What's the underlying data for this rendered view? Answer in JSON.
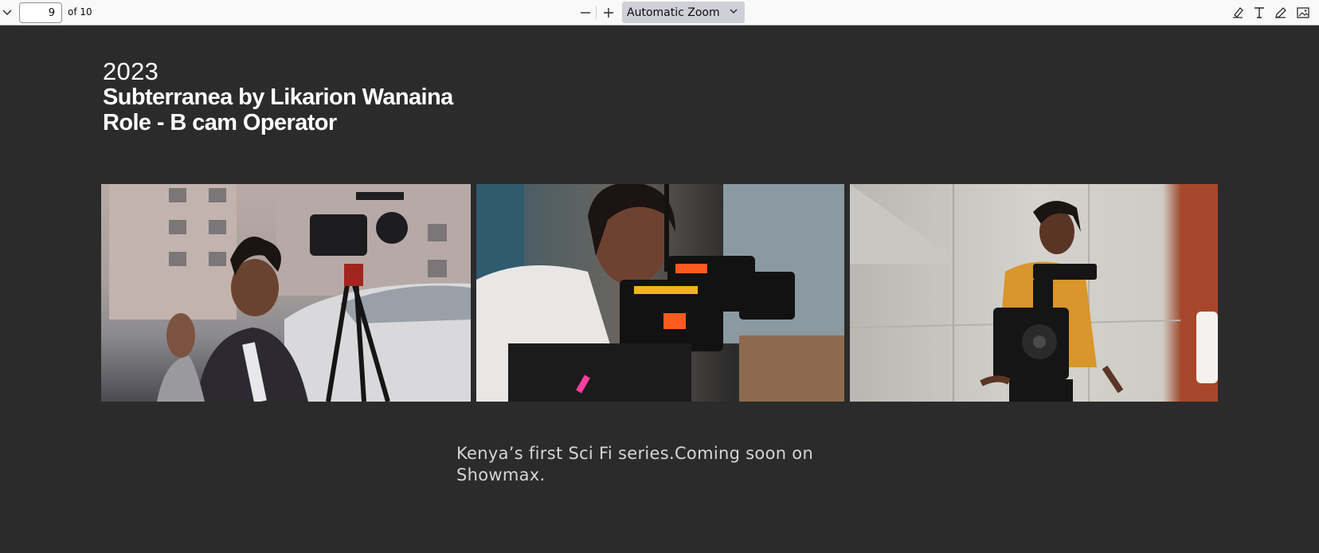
{
  "toolbar": {
    "page_number": "9",
    "page_count": "of 10",
    "zoom_value": "Automatic Zoom",
    "icons": {
      "sidebar": "chevron-down-icon",
      "zoom_out": "minus-icon",
      "zoom_in": "plus-icon",
      "highlight": "highlighter-icon",
      "text": "text-icon",
      "draw": "pen-icon",
      "image": "image-icon"
    }
  },
  "document": {
    "year": "2023",
    "title_line1": "Subterranea by Likarion Wanaina",
    "title_line2": "Role - B cam Operator",
    "caption_line1": "Kenya’s first Sci Fi series.Coming soon on",
    "caption_line2": "Showmax."
  },
  "colors": {
    "viewer_bg": "#2b2b2b",
    "toolbar_bg": "#f9f9fa",
    "zoom_select_bg": "#cfcfd8"
  }
}
